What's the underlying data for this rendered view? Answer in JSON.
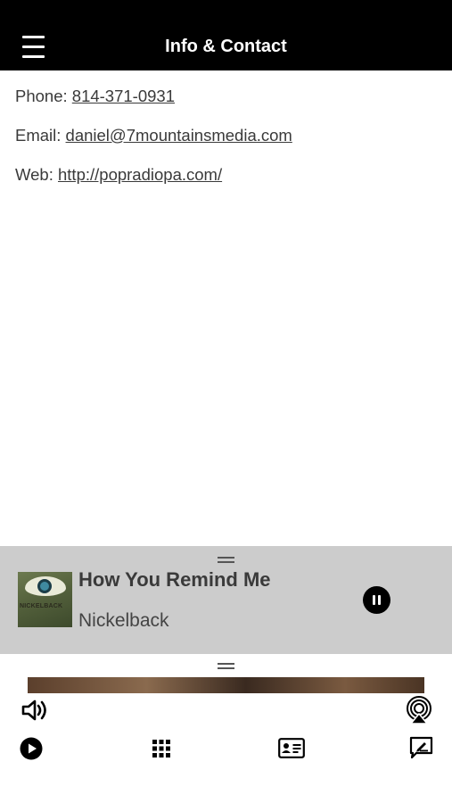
{
  "header": {
    "title": "Info & Contact",
    "menu_icon": "hamburger-menu-icon"
  },
  "contact": {
    "phone_label": "Phone:",
    "phone_value": "814-371-0931",
    "email_label": "Email:",
    "email_value": "daniel@7mountainsmedia.com",
    "web_label": "Web:",
    "web_value": "http://popradiopa.com/"
  },
  "now_playing": {
    "title": "How You Remind Me",
    "artist": "Nickelback",
    "album_art_text": "NICKELBACK",
    "state": "playing"
  },
  "player_controls": {
    "icons": [
      "volume-icon",
      "airplay-icon",
      "play-icon",
      "grid-icon",
      "contact-card-icon",
      "feedback-icon"
    ]
  },
  "colors": {
    "header_bg": "#000000",
    "now_playing_bg": "#cccccc",
    "text": "#3a3a3a"
  }
}
